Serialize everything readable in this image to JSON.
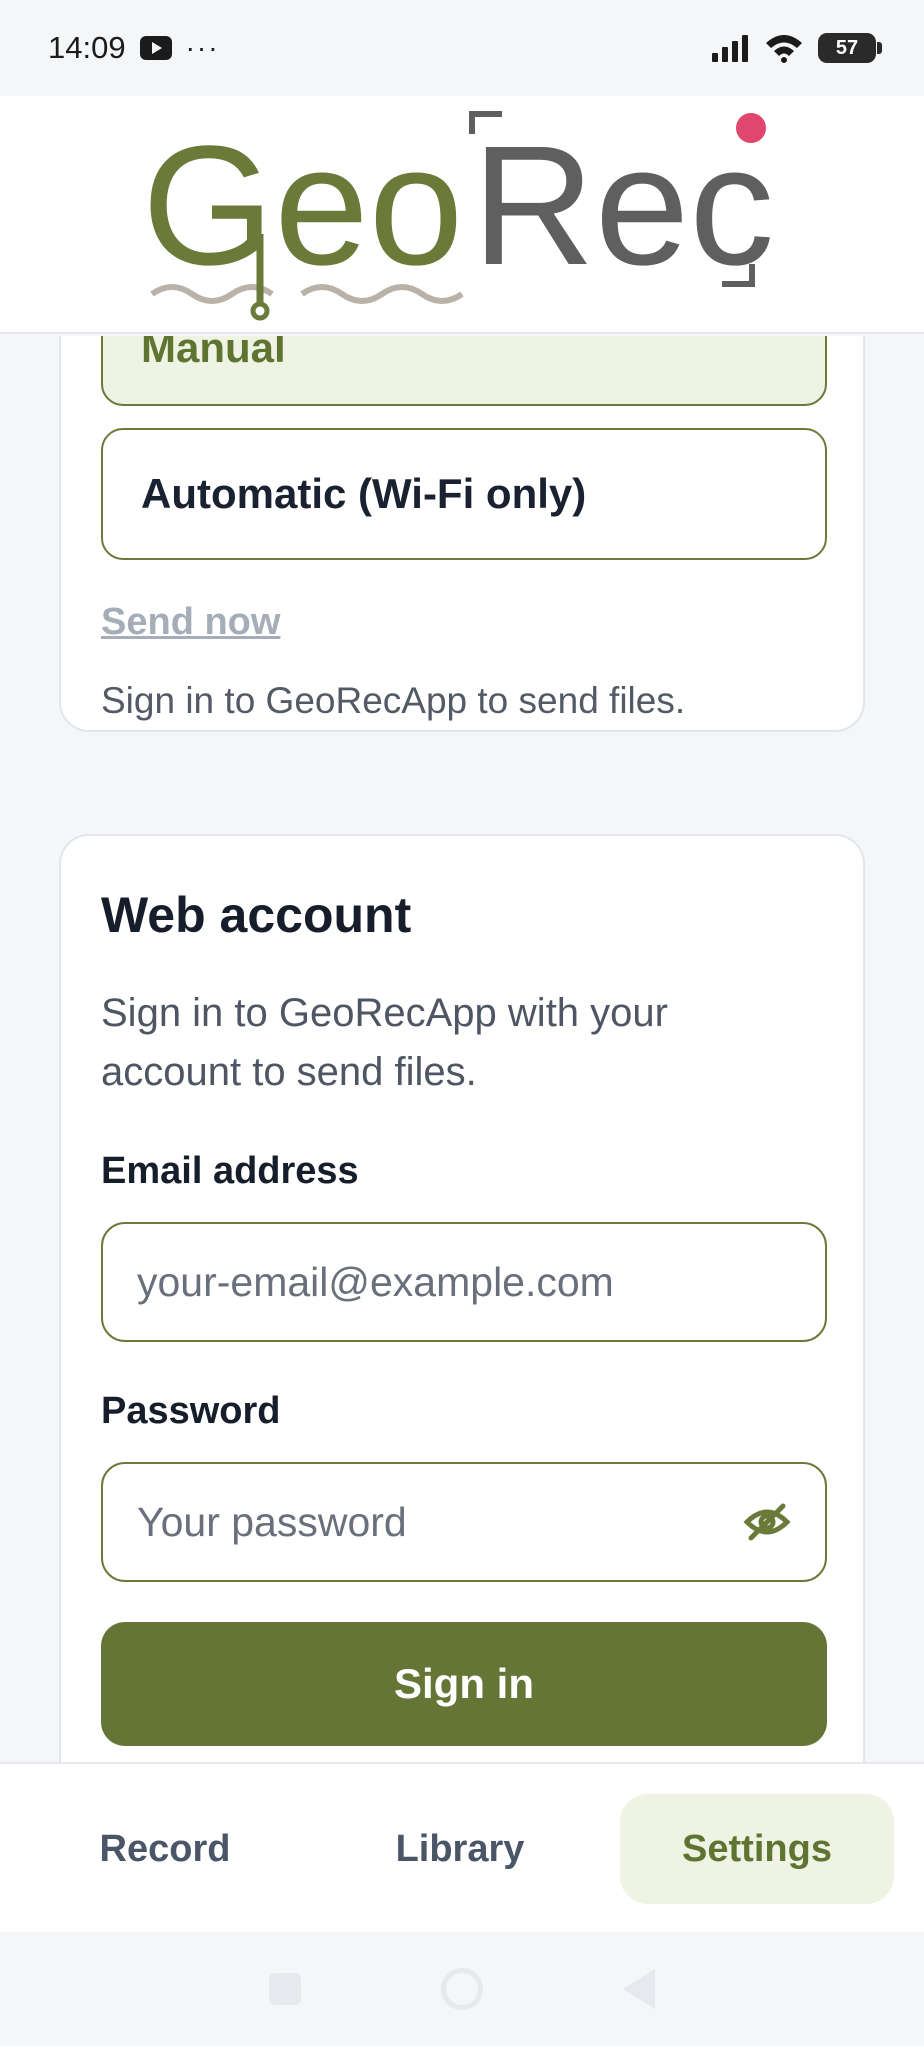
{
  "status_bar": {
    "time": "14:09",
    "more": "···",
    "battery": "57"
  },
  "header": {
    "logo_left": "Geo",
    "logo_right": "Rec"
  },
  "upload_section": {
    "options": [
      {
        "label": "Manual",
        "selected": true
      },
      {
        "label": "Automatic (Wi-Fi only)",
        "selected": false
      }
    ],
    "send_now": "Send now",
    "hint": "Sign in to GeoRecApp to send files."
  },
  "web_account": {
    "title": "Web account",
    "description": "Sign in to GeoRecApp with your account to send files.",
    "email_label": "Email address",
    "email_placeholder": "your-email@example.com",
    "email_value": "",
    "password_label": "Password",
    "password_placeholder": "Your password",
    "password_value": "",
    "sign_in": "Sign in"
  },
  "bottom_nav": {
    "items": [
      {
        "label": "Record",
        "active": false
      },
      {
        "label": "Library",
        "active": false
      },
      {
        "label": "Settings",
        "active": true
      }
    ]
  },
  "colors": {
    "brand_green": "#647535",
    "selected_bg": "#eef3e4",
    "logo_dot": "#e0466e",
    "logo_gray": "#5f5f5f"
  },
  "icons": [
    "wifi-icon",
    "signal-icon",
    "eye-off-icon",
    "youtube-icon"
  ]
}
